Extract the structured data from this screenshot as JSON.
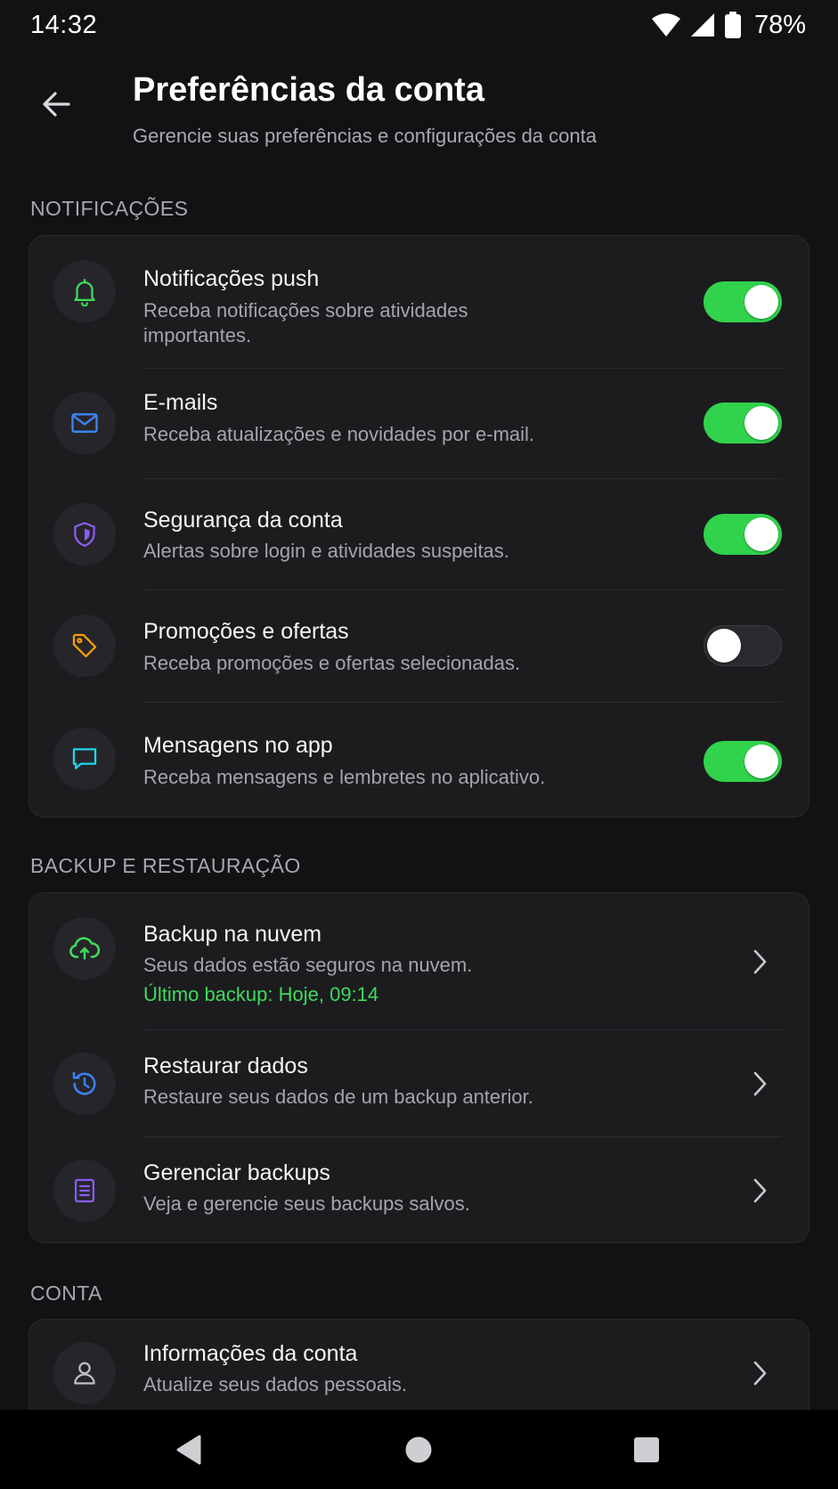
{
  "status_bar": {
    "time": "14:32",
    "battery": "78%"
  },
  "header": {
    "title": "Preferências da conta",
    "subtitle": "Gerencie suas preferências e configurações da conta"
  },
  "sections": {
    "notifications": {
      "title": "NOTIFICAÇÕES",
      "items": [
        {
          "title": "Notificações push",
          "description": "Receba notificações sobre atividades importantes.",
          "icon": "bell-icon",
          "enabled": true
        },
        {
          "title": "E-mails",
          "description": "Receba atualizações e novidades por e-mail.",
          "icon": "mail-icon",
          "enabled": true
        },
        {
          "title": "Segurança da conta",
          "description": "Alertas sobre login e atividades suspeitas.",
          "icon": "shield-icon",
          "enabled": true
        },
        {
          "title": "Promoções e ofertas",
          "description": "Receba promoções e ofertas selecionadas.",
          "icon": "tag-icon",
          "enabled": false
        },
        {
          "title": "Mensagens no app",
          "description": "Receba mensagens e lembretes no aplicativo.",
          "icon": "message-icon",
          "enabled": true
        }
      ]
    },
    "backup": {
      "title": "BACKUP E RESTAURAÇÃO",
      "items": [
        {
          "title": "Backup na nuvem",
          "description": "Seus dados estão seguros na nuvem.",
          "status": "Último backup: Hoje, 09:14",
          "icon": "cloud-upload-icon"
        },
        {
          "title": "Restaurar dados",
          "description": "Restaure seus dados de um backup anterior.",
          "icon": "history-icon"
        },
        {
          "title": "Gerenciar backups",
          "description": "Veja e gerencie seus backups salvos.",
          "icon": "document-icon"
        }
      ]
    },
    "account": {
      "title": "CONTA",
      "items": [
        {
          "title": "Informações da conta",
          "description": "Atualize seus dados pessoais.",
          "icon": "user-icon"
        }
      ]
    }
  },
  "colors": {
    "background": "#121214",
    "card": "#1c1c1f",
    "toggle_on": "#31d24c",
    "success_text": "#3ddc5c",
    "bell": "#3ddc5c",
    "mail": "#3b82f6",
    "shield": "#8b5cf6",
    "tag": "#f59e0b",
    "message": "#22d3ee",
    "cloud": "#3ddc5c",
    "history": "#3b82f6",
    "document": "#8b5cf6"
  }
}
